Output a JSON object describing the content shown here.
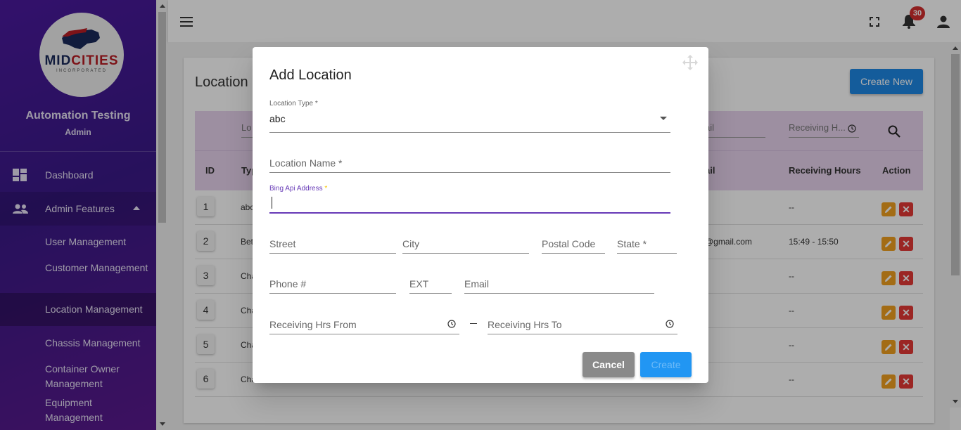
{
  "sidebar": {
    "logo": {
      "brand_mid": "MID",
      "brand_cities": "CITIES",
      "sub": "INCORPORATED"
    },
    "user_name": "Automation Testing",
    "user_role": "Admin",
    "nav": [
      {
        "label": "Dashboard",
        "icon": "dashboard-icon"
      },
      {
        "label": "Admin Features",
        "icon": "people-icon"
      }
    ],
    "sub_items": [
      "User Management",
      "Customer Management",
      "Location Management",
      "Chassis Management",
      "Container Owner Management",
      "Equipment Management"
    ]
  },
  "topbar": {
    "notification_count": "30",
    "icons": [
      "menu-icon",
      "fullscreen-icon",
      "bell-icon",
      "account-icon"
    ]
  },
  "page": {
    "title": "Location",
    "create_new_label": "Create New",
    "filters": {
      "type_placeholder": "Lo",
      "email_placeholder": "ail",
      "hours_placeholder": "Receiving H..."
    },
    "columns": {
      "id": "ID",
      "type": "Typ",
      "email": "ail",
      "hours": "Receiving Hours",
      "action": "Action"
    },
    "rows": [
      {
        "id": "1",
        "type": "abc",
        "email": "",
        "hours": "--"
      },
      {
        "id": "2",
        "type": "Bet",
        "email": "@gmail.com",
        "hours": "15:49 - 15:50"
      },
      {
        "id": "3",
        "type": "Cha",
        "email": "",
        "hours": "--"
      },
      {
        "id": "4",
        "type": "Cha",
        "email": "",
        "hours": "--"
      },
      {
        "id": "5",
        "type": "Cha",
        "email": "",
        "hours": "--"
      },
      {
        "id": "6",
        "type": "Cha",
        "email": "",
        "hours": "--"
      }
    ],
    "delete_glyph": "✕"
  },
  "modal": {
    "title": "Add Location",
    "location_type": {
      "label": "Location Type *",
      "value": "abc"
    },
    "location_name": {
      "placeholder": "Location Name *"
    },
    "bing_api": {
      "label": "Bing Api Address",
      "star": "*",
      "value": ""
    },
    "street": {
      "placeholder": "Street"
    },
    "city": {
      "placeholder": "City"
    },
    "postal_code": {
      "placeholder": "Postal Code"
    },
    "state": {
      "placeholder": "State *"
    },
    "phone": {
      "placeholder": "Phone #"
    },
    "ext": {
      "placeholder": "EXT"
    },
    "email": {
      "placeholder": "Email"
    },
    "hrs_from": {
      "placeholder": "Receiving Hrs From"
    },
    "hrs_to": {
      "placeholder": "Receiving Hrs To"
    },
    "cancel_label": "Cancel",
    "create_label": "Create"
  },
  "colors": {
    "sidebar": "#4b1a9e",
    "accent": "#673ab7",
    "primary_button": "#1e88e5",
    "edit_button": "#f0a020",
    "delete_button": "#e53935",
    "badge": "#d32f2f"
  }
}
